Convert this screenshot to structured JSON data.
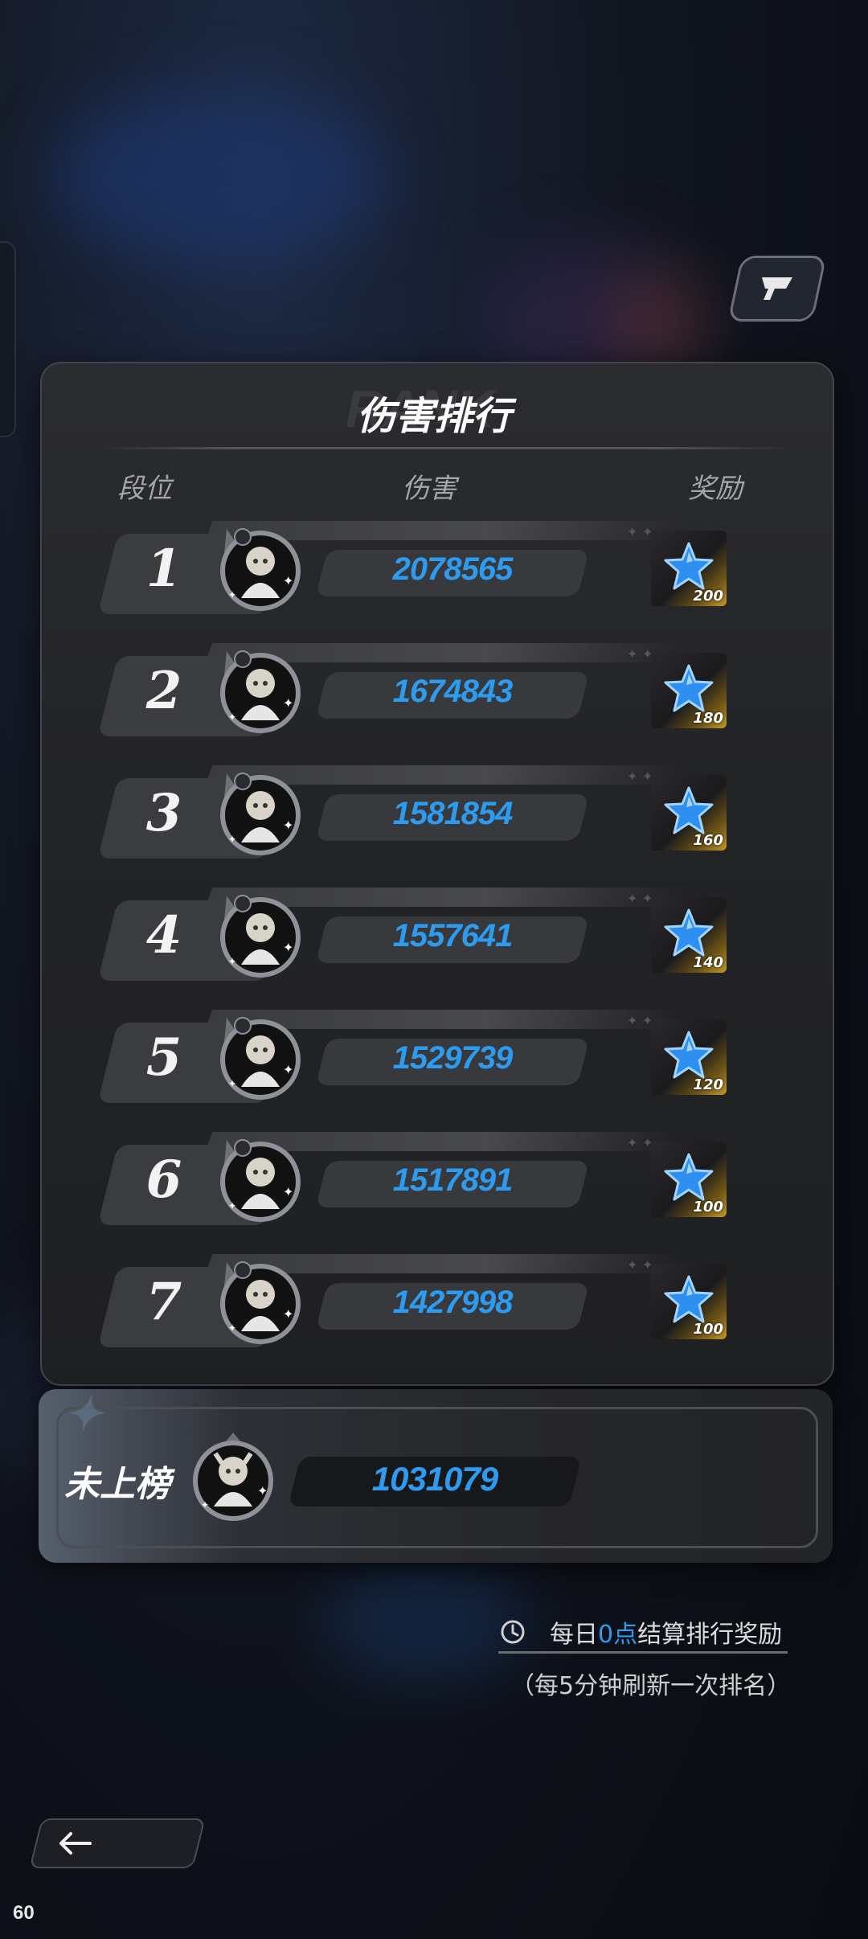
{
  "header": {
    "title": "伤害排行",
    "title_watermark": "RANK"
  },
  "columns": {
    "rank": "段位",
    "damage": "伤害",
    "reward": "奖励"
  },
  "rankings": [
    {
      "rank": "1",
      "damage": "2078565",
      "reward": "200"
    },
    {
      "rank": "2",
      "damage": "1674843",
      "reward": "180"
    },
    {
      "rank": "3",
      "damage": "1581854",
      "reward": "160"
    },
    {
      "rank": "4",
      "damage": "1557641",
      "reward": "140"
    },
    {
      "rank": "5",
      "damage": "1529739",
      "reward": "120"
    },
    {
      "rank": "6",
      "damage": "1517891",
      "reward": "100"
    },
    {
      "rank": "7",
      "damage": "1427998",
      "reward": "100"
    }
  ],
  "self": {
    "label": "未上榜",
    "damage": "1031079"
  },
  "notice": {
    "prefix": "每日",
    "highlight": "0点",
    "suffix": "结算排行奖励",
    "refresh": "（每5分钟刷新一次排名）"
  },
  "fps": "60",
  "colors": {
    "accent": "#2d9cf0",
    "panel": "#232426",
    "gold": "#c59a2a"
  },
  "icons": {
    "share": "share-icon",
    "back": "back-arrow-icon",
    "clock": "clock-icon",
    "reward": "star-icon"
  }
}
